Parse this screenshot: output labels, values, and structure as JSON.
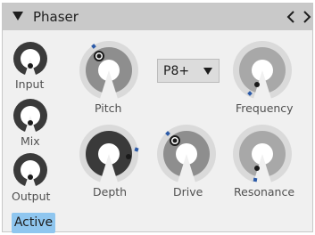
{
  "device": {
    "title": "Phaser",
    "collapse_icon": "triangle-down-icon",
    "prev_icon": "chevron-left-icon",
    "next_icon": "chevron-right-icon"
  },
  "controls": {
    "input": {
      "label": "Input"
    },
    "mix": {
      "label": "Mix"
    },
    "output": {
      "label": "Output"
    },
    "pitch": {
      "label": "Pitch"
    },
    "frequency": {
      "label": "Frequency"
    },
    "depth": {
      "label": "Depth"
    },
    "drive": {
      "label": "Drive"
    },
    "resonance": {
      "label": "Resonance"
    }
  },
  "mode_select": {
    "value": "P8+",
    "icon": "triangle-down-icon"
  },
  "active_button": {
    "label": "Active"
  },
  "colors": {
    "titlebar": "#c9c9c9",
    "panel": "#f0f0f0",
    "knob_dark": "#3a3a3a",
    "knob_light": "#bdbdbd",
    "knob_track": "#dadada",
    "accent": "#2b5aa8",
    "active": "#8fc6ef"
  }
}
